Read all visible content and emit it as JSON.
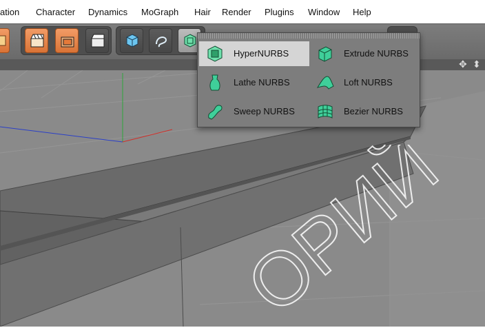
{
  "menu": {
    "items": [
      "ation",
      "Character",
      "Dynamics",
      "MoGraph",
      "Hair",
      "Render",
      "Plugins",
      "Window",
      "Help"
    ]
  },
  "popup": {
    "items": [
      {
        "label": "HyperNURBS",
        "icon": "hypernurbs-icon",
        "highlighted": true
      },
      {
        "label": "Extrude NURBS",
        "icon": "extrude-nurbs-icon",
        "highlighted": false
      },
      {
        "label": "Lathe NURBS",
        "icon": "lathe-nurbs-icon",
        "highlighted": false
      },
      {
        "label": "Loft NURBS",
        "icon": "loft-nurbs-icon",
        "highlighted": false
      },
      {
        "label": "Sweep NURBS",
        "icon": "sweep-nurbs-icon",
        "highlighted": false
      },
      {
        "label": "Bezier NURBS",
        "icon": "bezier-nurbs-icon",
        "highlighted": false
      }
    ]
  },
  "watermark": {
    "text": "ОРИЙ"
  },
  "colors": {
    "accent": "#e07a3a",
    "nurbs_icon": "#3fcf9a",
    "viewport": "#8a8a8a",
    "axis_x": "#d0302a",
    "axis_y": "#2fa53a",
    "axis_z": "#2a3fc8"
  }
}
